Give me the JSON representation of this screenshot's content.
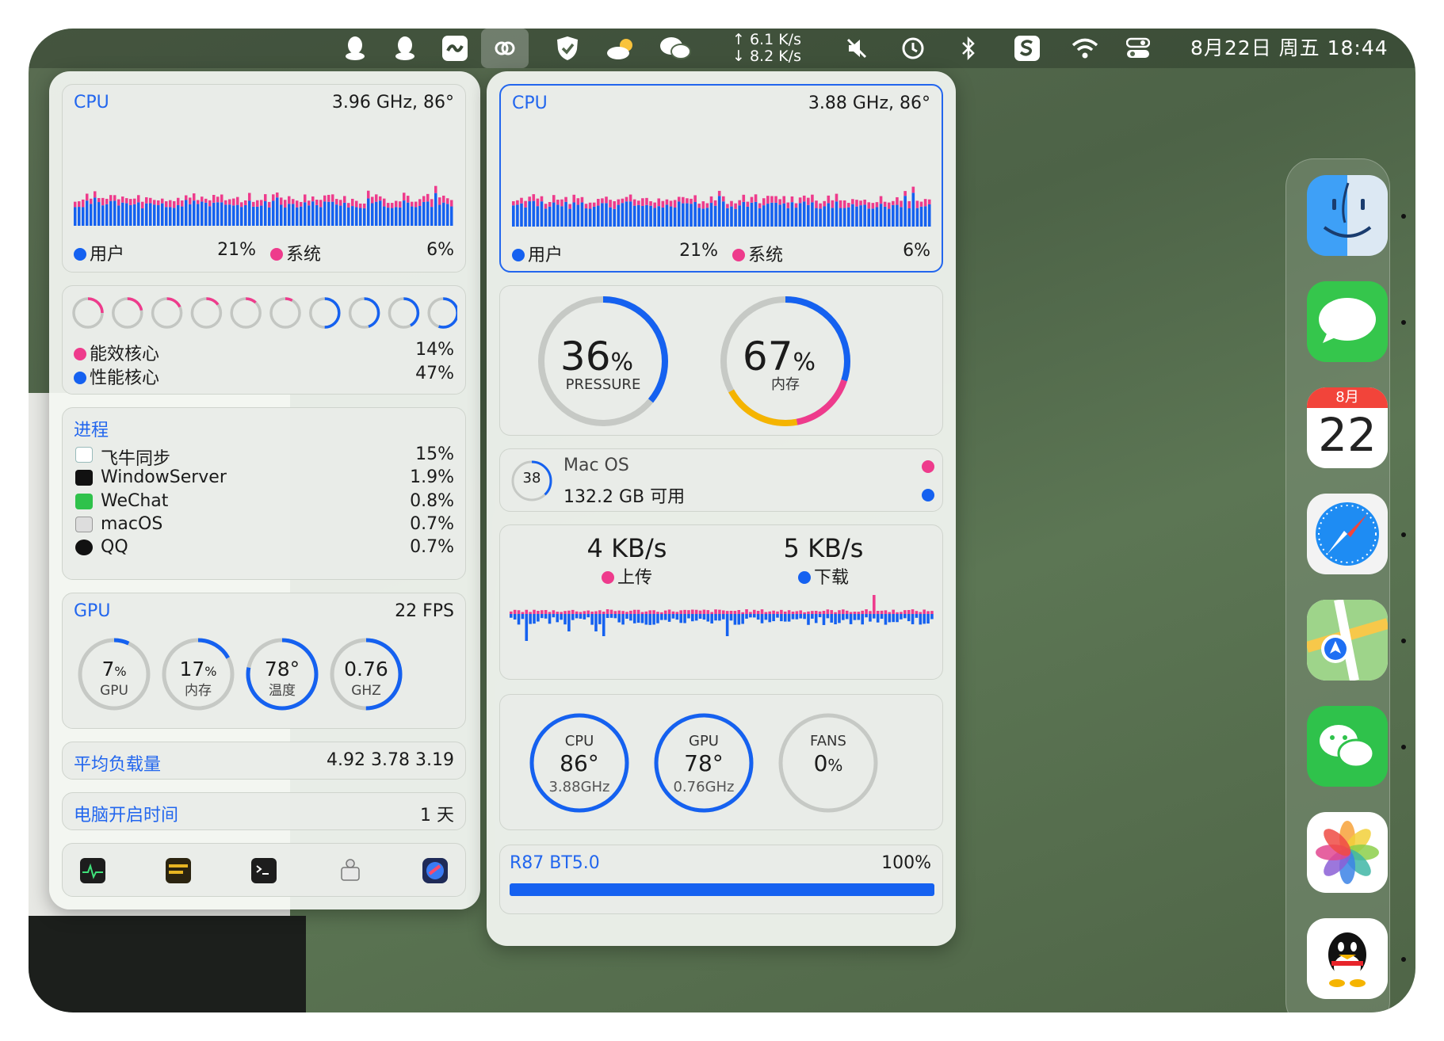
{
  "menubar": {
    "net_up": "↑ 6.1 K/s",
    "net_down": "↓ 8.2 K/s",
    "clock": "8月22日 周五  18:44",
    "icons": [
      "qq-icon",
      "qq-icon-2",
      "feiniu-icon",
      "link-icon",
      "shield-icon",
      "weather-icon",
      "wechat-icon",
      "mute-icon",
      "time-machine-icon",
      "bluetooth-icon",
      "sogou-icon",
      "wifi-icon",
      "control-center-icon"
    ]
  },
  "left": {
    "cpu": {
      "title": "CPU",
      "freq": "3.96 GHz, 86°",
      "user_label": "用户",
      "user_val": "21%",
      "sys_label": "系统",
      "sys_val": "6%"
    },
    "cores": {
      "eff_label": "能效核心",
      "eff_val": "14%",
      "perf_label": "性能核心",
      "perf_val": "47%",
      "eff_levels": [
        0.25,
        0.22,
        0.18,
        0.15,
        0.12,
        0.08
      ],
      "perf_levels": [
        0.5,
        0.45,
        0.42,
        0.55
      ]
    },
    "process": {
      "title": "进程",
      "items": [
        {
          "name": "飞牛同步",
          "val": "15%",
          "icon": "feiniu-icon"
        },
        {
          "name": "WindowServer",
          "val": "1.9%",
          "icon": "windowserver-icon"
        },
        {
          "name": "WeChat",
          "val": "0.8%",
          "icon": "wechat-icon"
        },
        {
          "name": "macOS",
          "val": "0.7%",
          "icon": "macos-icon"
        },
        {
          "name": "QQ",
          "val": "0.7%",
          "icon": "qq-icon"
        }
      ]
    },
    "gpu": {
      "title": "GPU",
      "fps": "22 FPS",
      "gauges": [
        {
          "value": "7",
          "unit": "%",
          "label": "GPU",
          "level": 0.07
        },
        {
          "value": "17",
          "unit": "%",
          "label": "内存",
          "level": 0.17
        },
        {
          "value": "78°",
          "unit": "",
          "label": "温度",
          "level": 0.78
        },
        {
          "value": "0.76",
          "unit": "",
          "label": "GHZ",
          "level": 0.5
        }
      ]
    },
    "load": {
      "label": "平均负载量",
      "values": "4.92 3.78 3.19"
    },
    "uptime": {
      "label": "电脑开启时间",
      "value": "1 天"
    },
    "shortcuts": [
      "activity-monitor-icon",
      "console-icon",
      "terminal-icon",
      "system-info-icon",
      "disk-utility-icon"
    ]
  },
  "right": {
    "cpu": {
      "title": "CPU",
      "freq": "3.88 GHz, 86°",
      "user_label": "用户",
      "user_val": "21%",
      "sys_label": "系统",
      "sys_val": "6%"
    },
    "pressure": {
      "value": "36",
      "unit": "%",
      "label": "PRESSURE",
      "level": 0.36
    },
    "memory": {
      "value": "67",
      "unit": "%",
      "label": "内存",
      "level": 0.67
    },
    "disk": {
      "ring": "38",
      "name": "Mac OS",
      "free": "132.2 GB 可用"
    },
    "network": {
      "up_val": "4 KB/s",
      "up_label": "上传",
      "down_val": "5 KB/s",
      "down_label": "下载"
    },
    "sensors": [
      {
        "title": "CPU",
        "value": "86°",
        "sub": "3.88GHz",
        "level": 1.0
      },
      {
        "title": "GPU",
        "value": "78°",
        "sub": "0.76GHz",
        "level": 1.0
      },
      {
        "title": "FANS",
        "value": "0",
        "unit": "%",
        "sub": "",
        "level": 0
      }
    ],
    "battery": {
      "name": "R87 BT5.0",
      "value": "100%",
      "level": 1.0
    }
  },
  "calendar": {
    "month": "8月",
    "day": "22"
  },
  "dock": [
    "finder-icon",
    "messages-icon",
    "calendar-icon",
    "safari-icon",
    "maps-icon",
    "wechat-icon",
    "photos-icon",
    "qq-icon"
  ],
  "colors": {
    "blue": "#1561f0",
    "pink": "#ee3b8c",
    "yellow": "#f5b400"
  }
}
